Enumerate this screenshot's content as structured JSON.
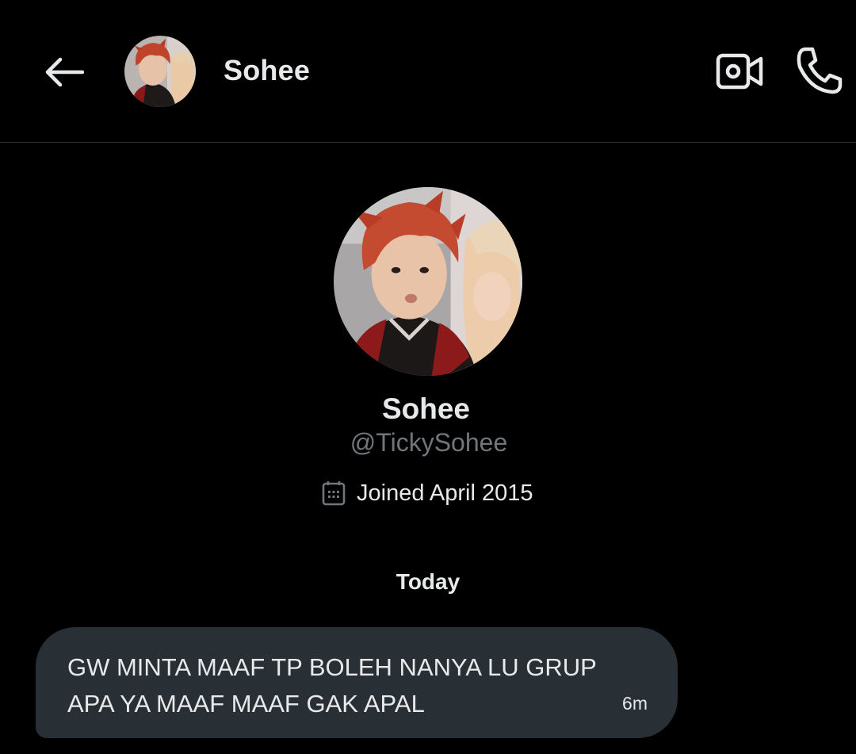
{
  "header": {
    "title": "Sohee",
    "back_icon": "arrow-left-icon",
    "video_icon": "video-camera-icon",
    "call_icon": "phone-icon"
  },
  "profile": {
    "name": "Sohee",
    "handle": "@TickySohee",
    "joined_icon": "calendar-icon",
    "joined": "Joined April 2015"
  },
  "conversation": {
    "day_label": "Today",
    "messages": [
      {
        "text": "GW MINTA MAAF TP BOLEH NANYA LU GRUP APA YA MAAF MAAF GAK APAL",
        "time": "6m"
      }
    ]
  },
  "colors": {
    "background": "#000000",
    "text_primary": "#e7e9ea",
    "text_secondary": "#71767b",
    "bubble": "#283036",
    "divider": "#2f3336"
  }
}
